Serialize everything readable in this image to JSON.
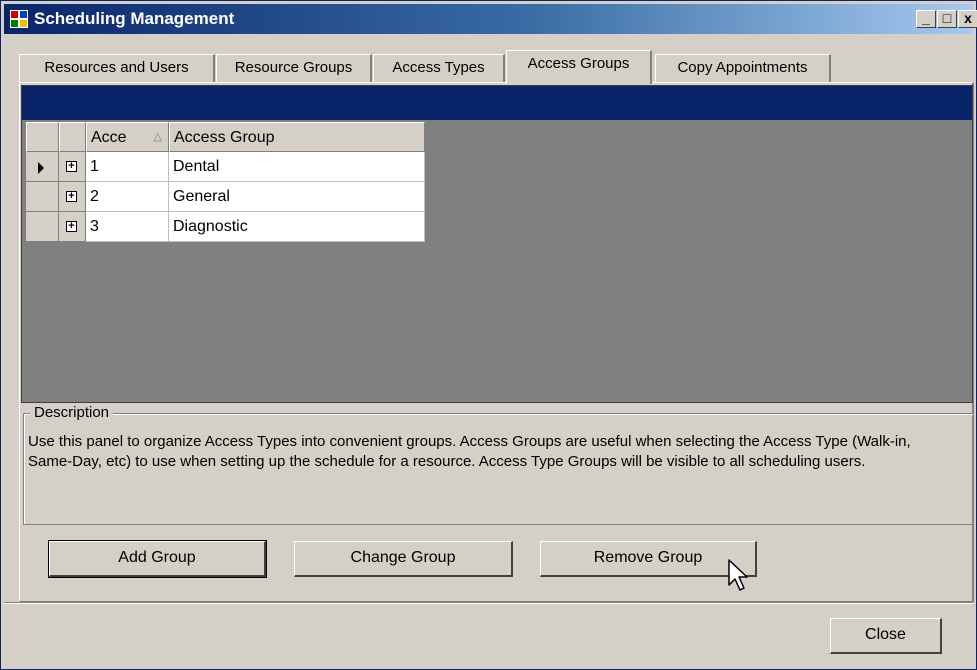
{
  "window": {
    "title": "Scheduling Management",
    "minimize": "_",
    "maximize": "□",
    "close": "x"
  },
  "tabs": [
    {
      "label": "Resources and Users"
    },
    {
      "label": "Resource Groups"
    },
    {
      "label": "Access Types"
    },
    {
      "label": "Access Groups",
      "active": true
    },
    {
      "label": "Copy Appointments"
    }
  ],
  "grid": {
    "columns": [
      "Acce",
      "Access Group"
    ],
    "sort_indicator": "△",
    "rows": [
      {
        "id": "1",
        "name": "Dental",
        "current": true
      },
      {
        "id": "2",
        "name": "General"
      },
      {
        "id": "3",
        "name": "Diagnostic"
      }
    ]
  },
  "description": {
    "legend": "Description",
    "text": "Use this panel to organize Access Types into convenient groups.  Access Groups are useful when selecting the Access Type (Walk-in, Same-Day, etc) to use when setting up the schedule for a resource.  Access Type Groups will be visible to all scheduling users."
  },
  "buttons": {
    "add": "Add Group",
    "change": "Change Group",
    "remove": "Remove Group",
    "close": "Close"
  },
  "colors": {
    "title_bar": "#0a246a",
    "window_face": "#d4d0c8",
    "grid_background": "#808080"
  }
}
